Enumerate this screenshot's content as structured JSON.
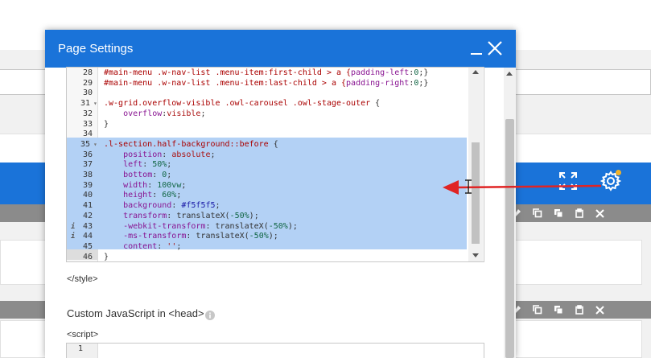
{
  "modal": {
    "title": "Page Settings",
    "minimize_icon": "minimize-icon",
    "close_icon": "close-icon"
  },
  "editor": {
    "lines": [
      {
        "n": "28",
        "parts": [
          [
            "c-sel",
            "#main-menu .w-nav-list .menu-item:first-child > a {"
          ],
          [
            "c-prop",
            "padding-left"
          ],
          [
            "c-plain",
            ":"
          ],
          [
            "c-num",
            "0"
          ],
          [
            "c-plain",
            ";}"
          ]
        ]
      },
      {
        "n": "29",
        "parts": [
          [
            "c-sel",
            "#main-menu .w-nav-list .menu-item:last-child > a {"
          ],
          [
            "c-prop",
            "padding-right"
          ],
          [
            "c-plain",
            ":"
          ],
          [
            "c-num",
            "0"
          ],
          [
            "c-plain",
            ";}"
          ]
        ]
      },
      {
        "n": "30",
        "parts": [
          [
            "c-plain",
            ""
          ]
        ]
      },
      {
        "n": "31",
        "fold": "▾",
        "parts": [
          [
            "c-sel",
            ".w-grid.overflow-visible .owl-carousel .owl-stage-outer"
          ],
          [
            "c-plain",
            " {"
          ]
        ]
      },
      {
        "n": "32",
        "parts": [
          [
            "c-plain",
            "    "
          ],
          [
            "c-prop",
            "overflow"
          ],
          [
            "c-plain",
            ":"
          ],
          [
            "c-val",
            "visible"
          ],
          [
            "c-plain",
            ";"
          ]
        ]
      },
      {
        "n": "33",
        "parts": [
          [
            "c-plain",
            "}"
          ]
        ]
      },
      {
        "n": "34",
        "parts": [
          [
            "c-plain",
            ""
          ]
        ]
      },
      {
        "n": "35",
        "fold": "▾",
        "parts": [
          [
            "c-sel",
            ".l-section.half-background::before"
          ],
          [
            "c-plain",
            " {"
          ]
        ]
      },
      {
        "n": "36",
        "parts": [
          [
            "c-plain",
            "    "
          ],
          [
            "c-prop",
            "position"
          ],
          [
            "c-plain",
            ": "
          ],
          [
            "c-val",
            "absolute"
          ],
          [
            "c-plain",
            ";"
          ]
        ]
      },
      {
        "n": "37",
        "parts": [
          [
            "c-plain",
            "    "
          ],
          [
            "c-prop",
            "left"
          ],
          [
            "c-plain",
            ": "
          ],
          [
            "c-num",
            "50%"
          ],
          [
            "c-plain",
            ";"
          ]
        ]
      },
      {
        "n": "38",
        "parts": [
          [
            "c-plain",
            "    "
          ],
          [
            "c-prop",
            "bottom"
          ],
          [
            "c-plain",
            ": "
          ],
          [
            "c-num",
            "0"
          ],
          [
            "c-plain",
            ";"
          ]
        ]
      },
      {
        "n": "39",
        "parts": [
          [
            "c-plain",
            "    "
          ],
          [
            "c-prop",
            "width"
          ],
          [
            "c-plain",
            ": "
          ],
          [
            "c-num",
            "100vw"
          ],
          [
            "c-plain",
            ";"
          ]
        ]
      },
      {
        "n": "40",
        "parts": [
          [
            "c-plain",
            "    "
          ],
          [
            "c-prop",
            "height"
          ],
          [
            "c-plain",
            ": "
          ],
          [
            "c-num",
            "60%"
          ],
          [
            "c-plain",
            ";"
          ]
        ]
      },
      {
        "n": "41",
        "parts": [
          [
            "c-plain",
            "    "
          ],
          [
            "c-prop",
            "background"
          ],
          [
            "c-plain",
            ": "
          ],
          [
            "c-key",
            "#f5f5f5"
          ],
          [
            "c-plain",
            ";"
          ]
        ]
      },
      {
        "n": "42",
        "parts": [
          [
            "c-plain",
            "    "
          ],
          [
            "c-prop",
            "transform"
          ],
          [
            "c-plain",
            ": "
          ],
          [
            "c-fn",
            "translateX("
          ],
          [
            "c-num",
            "-50%"
          ],
          [
            "c-fn",
            ")"
          ],
          [
            "c-plain",
            ";"
          ]
        ]
      },
      {
        "n": "43",
        "warn": "i",
        "parts": [
          [
            "c-plain",
            "    "
          ],
          [
            "c-prop",
            "-webkit-transform"
          ],
          [
            "c-plain",
            ": "
          ],
          [
            "c-fn",
            "translateX("
          ],
          [
            "c-num",
            "-50%"
          ],
          [
            "c-fn",
            ")"
          ],
          [
            "c-plain",
            ";"
          ]
        ]
      },
      {
        "n": "44",
        "warn": "i",
        "parts": [
          [
            "c-plain",
            "    "
          ],
          [
            "c-prop",
            "-ms-transform"
          ],
          [
            "c-plain",
            ": "
          ],
          [
            "c-fn",
            "translateX("
          ],
          [
            "c-num",
            "-50%"
          ],
          [
            "c-fn",
            ")"
          ],
          [
            "c-plain",
            ";"
          ]
        ]
      },
      {
        "n": "45",
        "parts": [
          [
            "c-plain",
            "    "
          ],
          [
            "c-prop",
            "content"
          ],
          [
            "c-plain",
            ": "
          ],
          [
            "c-str",
            "''"
          ],
          [
            "c-plain",
            ";"
          ]
        ]
      },
      {
        "n": "46",
        "parts": [
          [
            "c-plain",
            "}"
          ]
        ]
      }
    ]
  },
  "style_close_tag": "</style>",
  "js_section": {
    "label": "Custom JavaScript in <head>",
    "info_icon": "info-icon",
    "script_open_tag": "<script>",
    "first_line_number": "1"
  },
  "background": {
    "header_icons": [
      "expand-icon",
      "gear-icon"
    ],
    "bar_tools": [
      "brush-icon",
      "copy-icon",
      "duplicate-icon",
      "paste-icon",
      "close-icon"
    ],
    "card_chevrons": [
      "chevron-up-icon",
      "chevron-down-icon",
      "caret-down-icon"
    ],
    "colors": {
      "accent": "#1a73d9",
      "selection": "#b3d1f5",
      "annotation": "#e02424",
      "notify": "#f1b32a"
    }
  }
}
